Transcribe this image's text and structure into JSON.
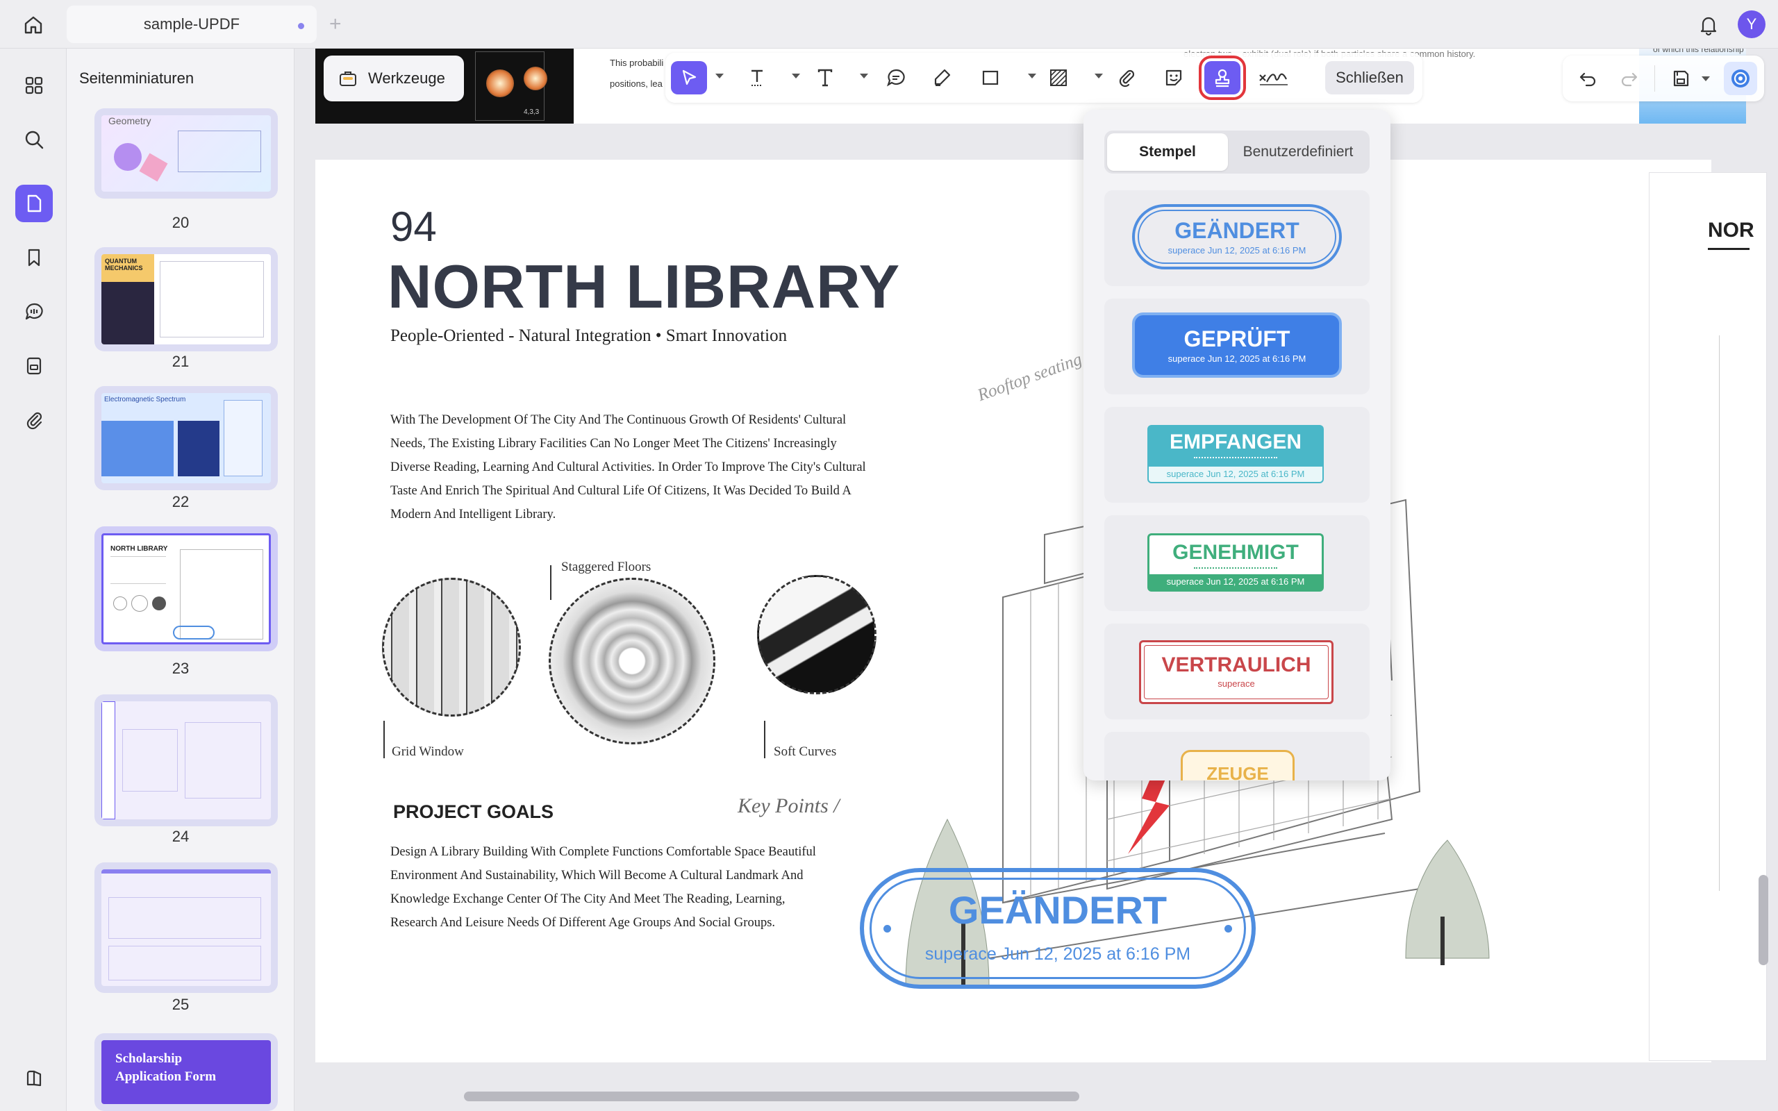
{
  "tabs": {
    "active": "sample-UPDF"
  },
  "user": {
    "avatar_initial": "Y"
  },
  "sidebar": {
    "title": "Seitenminiaturen"
  },
  "thumbnails": [
    {
      "page": "20",
      "label": "Geometry"
    },
    {
      "page": "21",
      "label": "QUANTUM MECHANICS"
    },
    {
      "page": "22",
      "label": "Electromagnetic Spectrum"
    },
    {
      "page": "23",
      "label": "NORTH LIBRARY"
    },
    {
      "page": "24",
      "label": ""
    },
    {
      "page": "25",
      "label": ""
    },
    {
      "page": "",
      "label": "Scholarship Application Form"
    }
  ],
  "toolbar": {
    "tools_label": "Werkzeuge",
    "close_label": "Schließen"
  },
  "stamp_panel": {
    "tab_stamps": "Stempel",
    "tab_custom": "Benutzerdefiniert",
    "stamps": [
      {
        "title": "GEÄNDERT",
        "sub": "superace Jun 12, 2025 at 6:16 PM",
        "color": "#4f8ee0"
      },
      {
        "title": "GEPRÜFT",
        "sub": "superace Jun 12, 2025 at 6:16 PM",
        "color": "#3f7fe6"
      },
      {
        "title": "EMPFANGEN",
        "sub": "superace Jun 12, 2025 at 6:16 PM",
        "color": "#4ab7c8"
      },
      {
        "title": "GENEHMIGT",
        "sub": "superace Jun 12, 2025 at 6:16 PM",
        "color": "#3fae7c"
      },
      {
        "title": "VERTRAULICH",
        "sub": "superace",
        "color": "#c9464a"
      },
      {
        "title": "ZEUGE",
        "sub": "",
        "color": "#e8b24a"
      }
    ]
  },
  "document": {
    "prev_page_snippets": {
      "left": "This probabili positions, lea",
      "top": "electron two... exhibit (dual role) if both particles share a common history.",
      "right": "of which this relationship",
      "figure_value": "4,3,3"
    },
    "page_number": "94",
    "title": "NORTH LIBRARY",
    "subtitle": "People-Oriented - Natural Integration • Smart Innovation",
    "body": "With The Development Of The City And The Continuous Growth Of Residents' Cultural Needs, The Existing Library Facilities Can No Longer Meet The Citizens' Increasingly Diverse Reading, Learning And Cultural Activities. In Order To Improve The City's Cultural Taste And Enrich The Spiritual And Cultural Life Of Citizens, It Was Decided To Build A Modern And Intelligent Library.",
    "captions": {
      "staggered": "Staggered Floors",
      "grid": "Grid Window",
      "soft": "Soft Curves",
      "rooftop": "Rooftop seating"
    },
    "goals_heading": "PROJECT GOALS",
    "key_points": "Key Points /",
    "goals_body": "Design A Library Building With Complete Functions Comfortable Space Beautiful Environment And Sustainability, Which Will Become A Cultural Landmark And Knowledge Exchange Center Of The City And Meet The Reading, Learning, Research And Leisure Needs Of Different Age Groups And Social Groups.",
    "placed_stamp": {
      "title": "GEÄNDERT",
      "sub": "superace Jun 12, 2025 at 6:16 PM"
    },
    "next_page_title": "NOR"
  },
  "colors": {
    "accent": "#6d5cf2",
    "highlight": "#e2363c",
    "stamp_blue": "#4f8ee0"
  }
}
